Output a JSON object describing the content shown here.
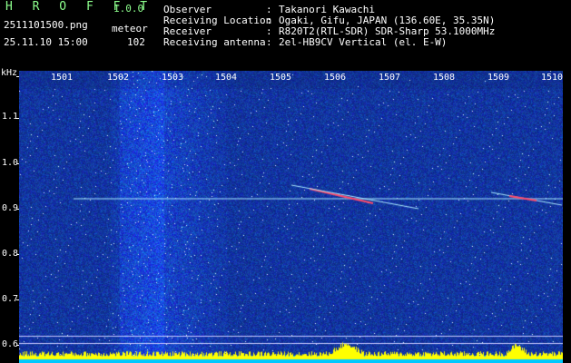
{
  "header": {
    "app_title": "H R O F F T",
    "app_version": "1.0.0",
    "file_name": "2511101500.png",
    "type_label": "meteor",
    "date_time": "25.11.10 15:00",
    "count": "102"
  },
  "info": [
    {
      "key": "Observer",
      "value": "Takanori Kawachi"
    },
    {
      "key": "Receiving Location",
      "value": "Ogaki, Gifu, JAPAN (136.60E, 35.35N)"
    },
    {
      "key": "Receiver",
      "value": "R820T2(RTL-SDR) SDR-Sharp 53.1000MHz"
    },
    {
      "key": "Receiving antenna",
      "value": "2el-HB9CV Vertical (el. E-W)"
    }
  ],
  "info_separator": ":",
  "y_unit": "kHz",
  "x_ticks": [
    "1501",
    "1502",
    "1503",
    "1504",
    "1505",
    "1506",
    "1507",
    "1508",
    "1509",
    "1510"
  ],
  "y_ticks": [
    "1.1",
    "1.0",
    "0.9",
    "0.8",
    "0.7",
    "0.6"
  ],
  "colors": {
    "background": "#000000",
    "noise_base": "#0a1a78",
    "noise_bright": "#3a64ff",
    "carrier": "#a8e8ff",
    "meteor": "#ff4a6a",
    "bottom_bar": "#ffff00",
    "bottom_base": "#00c8ff",
    "guide_line": "#c8c8ff"
  }
}
